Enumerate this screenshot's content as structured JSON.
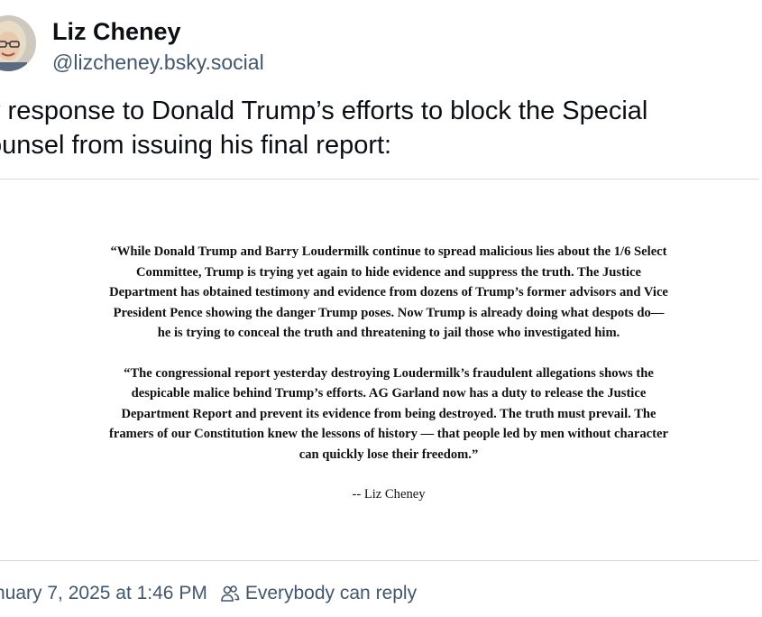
{
  "author": {
    "display_name": "Liz Cheney",
    "handle": "@lizcheney.bsky.social",
    "avatar_icon": "avatar-photo"
  },
  "post": {
    "text_lines": [
      "y response to Donald Trump’s efforts to block the Special",
      "ounsel from issuing his final report:"
    ]
  },
  "statement": {
    "paragraph1_lines": [
      "“While Donald Trump and Barry Loudermilk continue to spread malicious lies about the 1/6 Select",
      "Committee, Trump is trying yet again to hide evidence and suppress the truth. The Justice",
      "Department has obtained testimony and evidence from dozens of Trump’s former advisors and Vice",
      "President Pence showing the danger Trump poses. Now Trump is already doing what despots do—",
      "he is trying to conceal the truth and threatening to jail those who investigated him."
    ],
    "paragraph2_lines": [
      "“The congressional report yesterday destroying Loudermilk’s fraudulent allegations shows the",
      "despicable malice behind Trump’s efforts. AG Garland now has a duty to release the Justice",
      "Department Report and prevent its evidence from being destroyed. The truth must prevail. The",
      "framers of our Constitution knew the lessons of history — that people led by men without character",
      "can quickly lose their freedom.”"
    ],
    "signature": "-- Liz Cheney"
  },
  "meta": {
    "timestamp": "nuary 7, 2025 at 1:46 PM",
    "reply_setting": "Everybody can reply",
    "reply_icon": "people-icon"
  },
  "colors": {
    "text_primary": "#0b0f14",
    "text_secondary": "#42576c",
    "border": "#d4dbe2"
  }
}
